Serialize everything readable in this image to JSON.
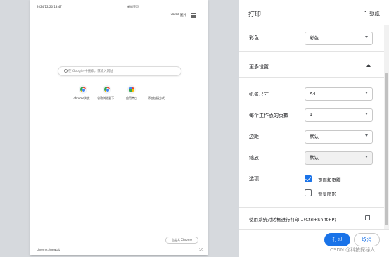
{
  "preview": {
    "header_date": "2024/12/20 13:47",
    "header_title": "新标签页",
    "top_links": [
      "Gmail",
      "图片"
    ],
    "search_placeholder": "在 Google 中搜索，或输入网址",
    "shortcuts": [
      {
        "label": "chrome浏览...",
        "icon": "chrome-icon"
      },
      {
        "label": "谷歌浏览器下...",
        "icon": "chrome-icon"
      },
      {
        "label": "应用商店",
        "icon": "web-store-icon"
      },
      {
        "label": "添加快捷方式",
        "icon": "add-shortcut-icon"
      }
    ],
    "customize_label": "自定义 Chrome",
    "footer_left": "chrome://newtab",
    "footer_right": "1/1"
  },
  "panel": {
    "title": "打印",
    "sheet_count": "1 张纸",
    "color": {
      "label": "彩色",
      "value": "彩色"
    },
    "more_settings_label": "更多设置",
    "paper_size": {
      "label": "纸张尺寸",
      "value": "A4"
    },
    "pages_per_sheet": {
      "label": "每个工作表的页数",
      "value": "1"
    },
    "margins": {
      "label": "边距",
      "value": "默认"
    },
    "scale": {
      "label": "缩放",
      "value": "默认"
    },
    "options": {
      "label": "选项",
      "headers_footers": {
        "label": "页眉和页脚",
        "checked": true
      },
      "background_graphics": {
        "label": "背景图形",
        "checked": false
      }
    },
    "system_dialog_label": "使用系统对话框进行打印...(Ctrl+Shift+P)",
    "print_button": "打印",
    "cancel_button": "取消"
  },
  "watermark": "CSDN @科技探秘人",
  "colors": {
    "accent": "#1a73e8",
    "preview_bg": "#d6d9dd"
  }
}
